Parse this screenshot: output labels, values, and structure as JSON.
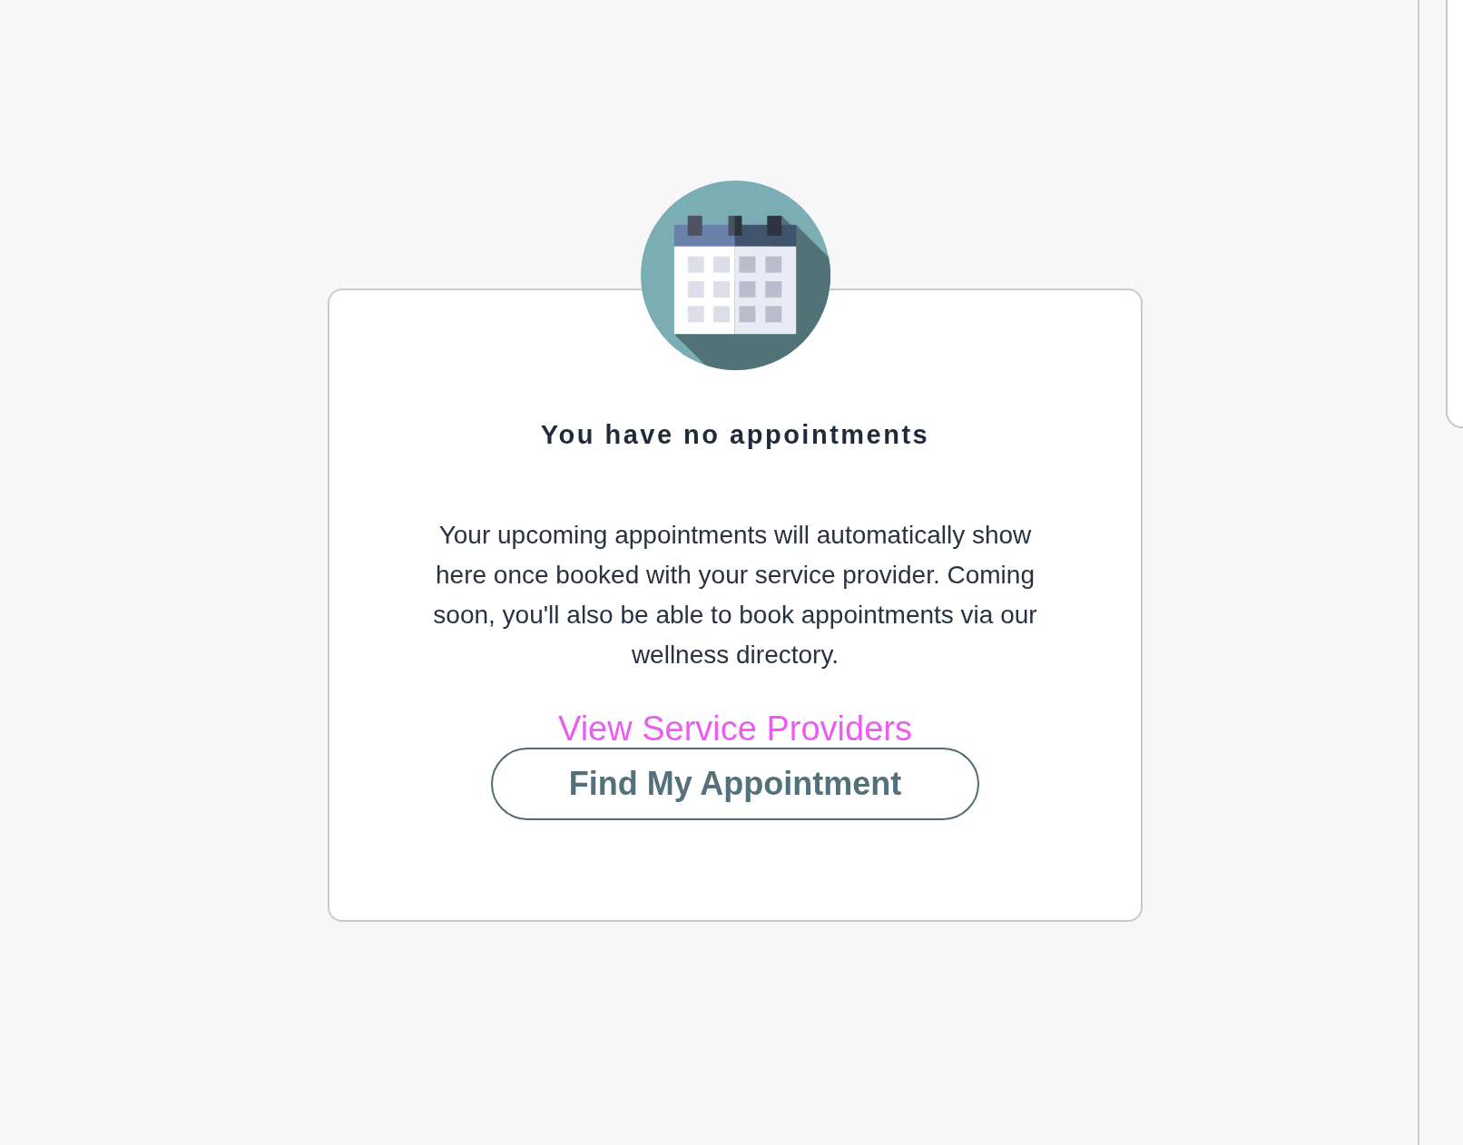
{
  "empty_state": {
    "heading": "You have no appointments",
    "message": "Your upcoming appointments will automatically show here once booked with your service provider. Coming soon, you'll also be able to book appointments via our wellness directory.",
    "link": "View Service Providers",
    "button": "Find My Appointment"
  }
}
